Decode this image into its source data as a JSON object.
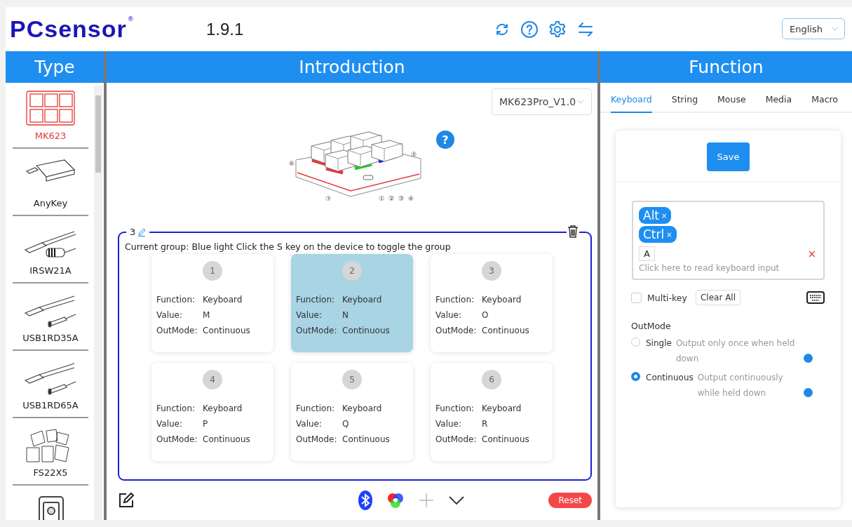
{
  "header": {
    "logo": "PCsensor",
    "logo_mark": "®",
    "version": "1.9.1",
    "language": "English"
  },
  "type_panel": {
    "title": "Type",
    "items": [
      {
        "label": "MK623",
        "kind": "keypad",
        "selected": true
      },
      {
        "label": "AnyKey",
        "kind": "dongle",
        "selected": false
      },
      {
        "label": "IRSW21A",
        "kind": "cable-coil",
        "selected": false
      },
      {
        "label": "USB1RD35A",
        "kind": "cable-plug",
        "selected": false
      },
      {
        "label": "USB1RD65A",
        "kind": "cable-plug",
        "selected": false
      },
      {
        "label": "FS22X5",
        "kind": "pedals",
        "selected": false
      },
      {
        "kind": "pedal",
        "selected": false
      }
    ]
  },
  "intro_panel": {
    "title": "Introduction",
    "model": "MK623Pro_V1.0",
    "help": "?",
    "callouts": [
      "①",
      "②",
      "③",
      "④",
      "⑤",
      "⑥",
      "⑦"
    ],
    "group": {
      "number": "3",
      "description": "Current group: Blue light Click the S key on the device to toggle the group",
      "keys": [
        {
          "number": "1",
          "selected": false,
          "fields": [
            {
              "label": "Function:",
              "value": "Keyboard"
            },
            {
              "label": "Value:",
              "value": "M"
            },
            {
              "label": "OutMode:",
              "value": "Continuous"
            }
          ]
        },
        {
          "number": "2",
          "selected": true,
          "fields": [
            {
              "label": "Function:",
              "value": "Keyboard"
            },
            {
              "label": "Value:",
              "value": "N"
            },
            {
              "label": "OutMode:",
              "value": "Continuous"
            }
          ]
        },
        {
          "number": "3",
          "selected": false,
          "fields": [
            {
              "label": "Function:",
              "value": "Keyboard"
            },
            {
              "label": "Value:",
              "value": "O"
            },
            {
              "label": "OutMode:",
              "value": "Continuous"
            }
          ]
        },
        {
          "number": "4",
          "selected": false,
          "fields": [
            {
              "label": "Function:",
              "value": "Keyboard"
            },
            {
              "label": "Value:",
              "value": "P"
            },
            {
              "label": "OutMode:",
              "value": "Continuous"
            }
          ]
        },
        {
          "number": "5",
          "selected": false,
          "fields": [
            {
              "label": "Function:",
              "value": "Keyboard"
            },
            {
              "label": "Value:",
              "value": "Q"
            },
            {
              "label": "OutMode:",
              "value": "Continuous"
            }
          ]
        },
        {
          "number": "6",
          "selected": false,
          "fields": [
            {
              "label": "Function:",
              "value": "Keyboard"
            },
            {
              "label": "Value:",
              "value": "R"
            },
            {
              "label": "OutMode:",
              "value": "Continuous"
            }
          ]
        }
      ]
    },
    "reset": "Reset"
  },
  "function_panel": {
    "title": "Function",
    "tabs": [
      {
        "label": "Keyboard",
        "selected": true
      },
      {
        "label": "String",
        "selected": false
      },
      {
        "label": "Mouse",
        "selected": false
      },
      {
        "label": "Media",
        "selected": false
      },
      {
        "label": "Macro",
        "selected": false
      }
    ],
    "save": "Save",
    "modifiers": [
      {
        "label": "Alt",
        "remove": "×"
      },
      {
        "label": "Ctrl",
        "remove": "×"
      }
    ],
    "key": "A",
    "clear": "×",
    "placeholder": "Click here to read keyboard input",
    "multi_key": {
      "label": "Multi-key",
      "checked": false
    },
    "clear_all": "Clear All",
    "outmode": {
      "title": "OutMode",
      "options": [
        {
          "label": "Single",
          "description": "Output only once when held down",
          "selected": false
        },
        {
          "label": "Continuous",
          "description": "Output continuously while held down",
          "selected": true
        }
      ]
    }
  }
}
